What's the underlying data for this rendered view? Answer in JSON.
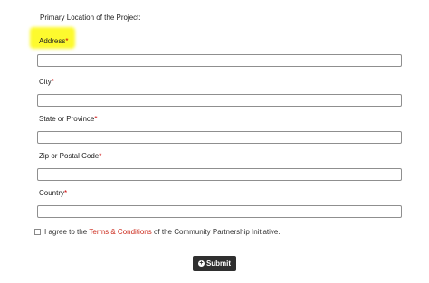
{
  "form": {
    "section_title": "Primary Location of the Project:",
    "required_marker": "*",
    "fields": {
      "address": {
        "label": "Address",
        "value": "",
        "placeholder": ""
      },
      "city": {
        "label": "City",
        "value": "",
        "placeholder": ""
      },
      "state": {
        "label": "State or Province",
        "value": "",
        "placeholder": ""
      },
      "zip": {
        "label": "Zip or Postal Code",
        "value": "",
        "placeholder": ""
      },
      "country": {
        "label": "Country",
        "value": "",
        "placeholder": ""
      }
    },
    "agree": {
      "checked": false,
      "prefix": "I agree to the ",
      "link": "Terms & Conditions",
      "suffix": " of the Community Partnership Initiative."
    },
    "submit": {
      "label": "Submit",
      "icon": "plus-circle-icon"
    },
    "colors": {
      "required": "#cc0000",
      "link": "#cc2b1d",
      "highlight": "#fdfa2e",
      "button": "#2f2f2f"
    }
  }
}
